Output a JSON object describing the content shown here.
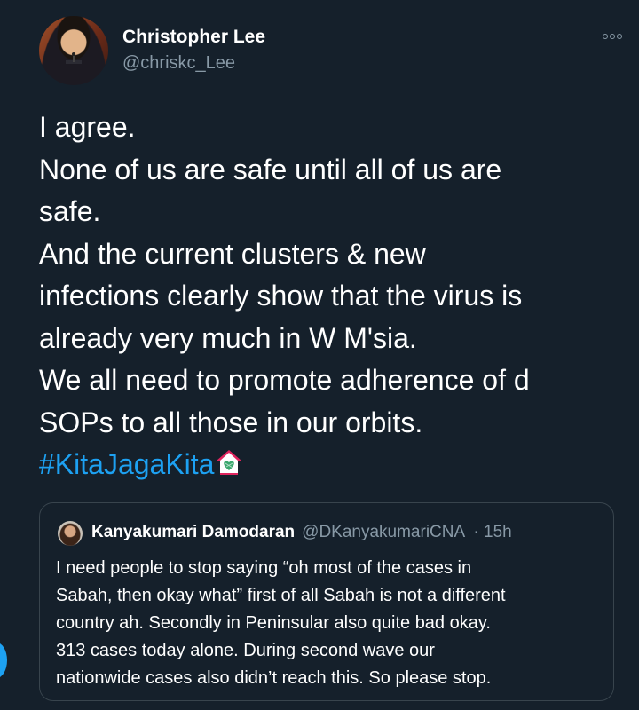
{
  "author": {
    "name": "Christopher Lee",
    "handle": "@chriskc_Lee"
  },
  "tweet": {
    "lines": [
      "I agree.",
      "None of us are safe until all of us are",
      "safe.",
      "And the current clusters & new",
      "infections clearly show that the virus is",
      "already very much in W M'sia.",
      "We all need to promote adherence of d",
      "SOPs to all those in our orbits."
    ],
    "hashtag": "#KitaJagaKita",
    "emoji": "house-with-heart-icon"
  },
  "quoted": {
    "name": "Kanyakumari Damodaran",
    "handle": "@DKanyakumariCNA",
    "time": "· 15h",
    "lines": [
      "I need people to stop saying “oh most of the cases in",
      "Sabah, then okay what” first of all Sabah is not a different",
      "country ah. Secondly in Peninsular also quite bad okay.",
      "313 cases today alone. During second wave our",
      "nationwide cases also didn’t reach this. So please stop."
    ]
  },
  "colors": {
    "background": "#15202b",
    "text": "#ffffff",
    "secondary": "#8899a6",
    "accent": "#1da1f2",
    "border": "#38444d"
  }
}
